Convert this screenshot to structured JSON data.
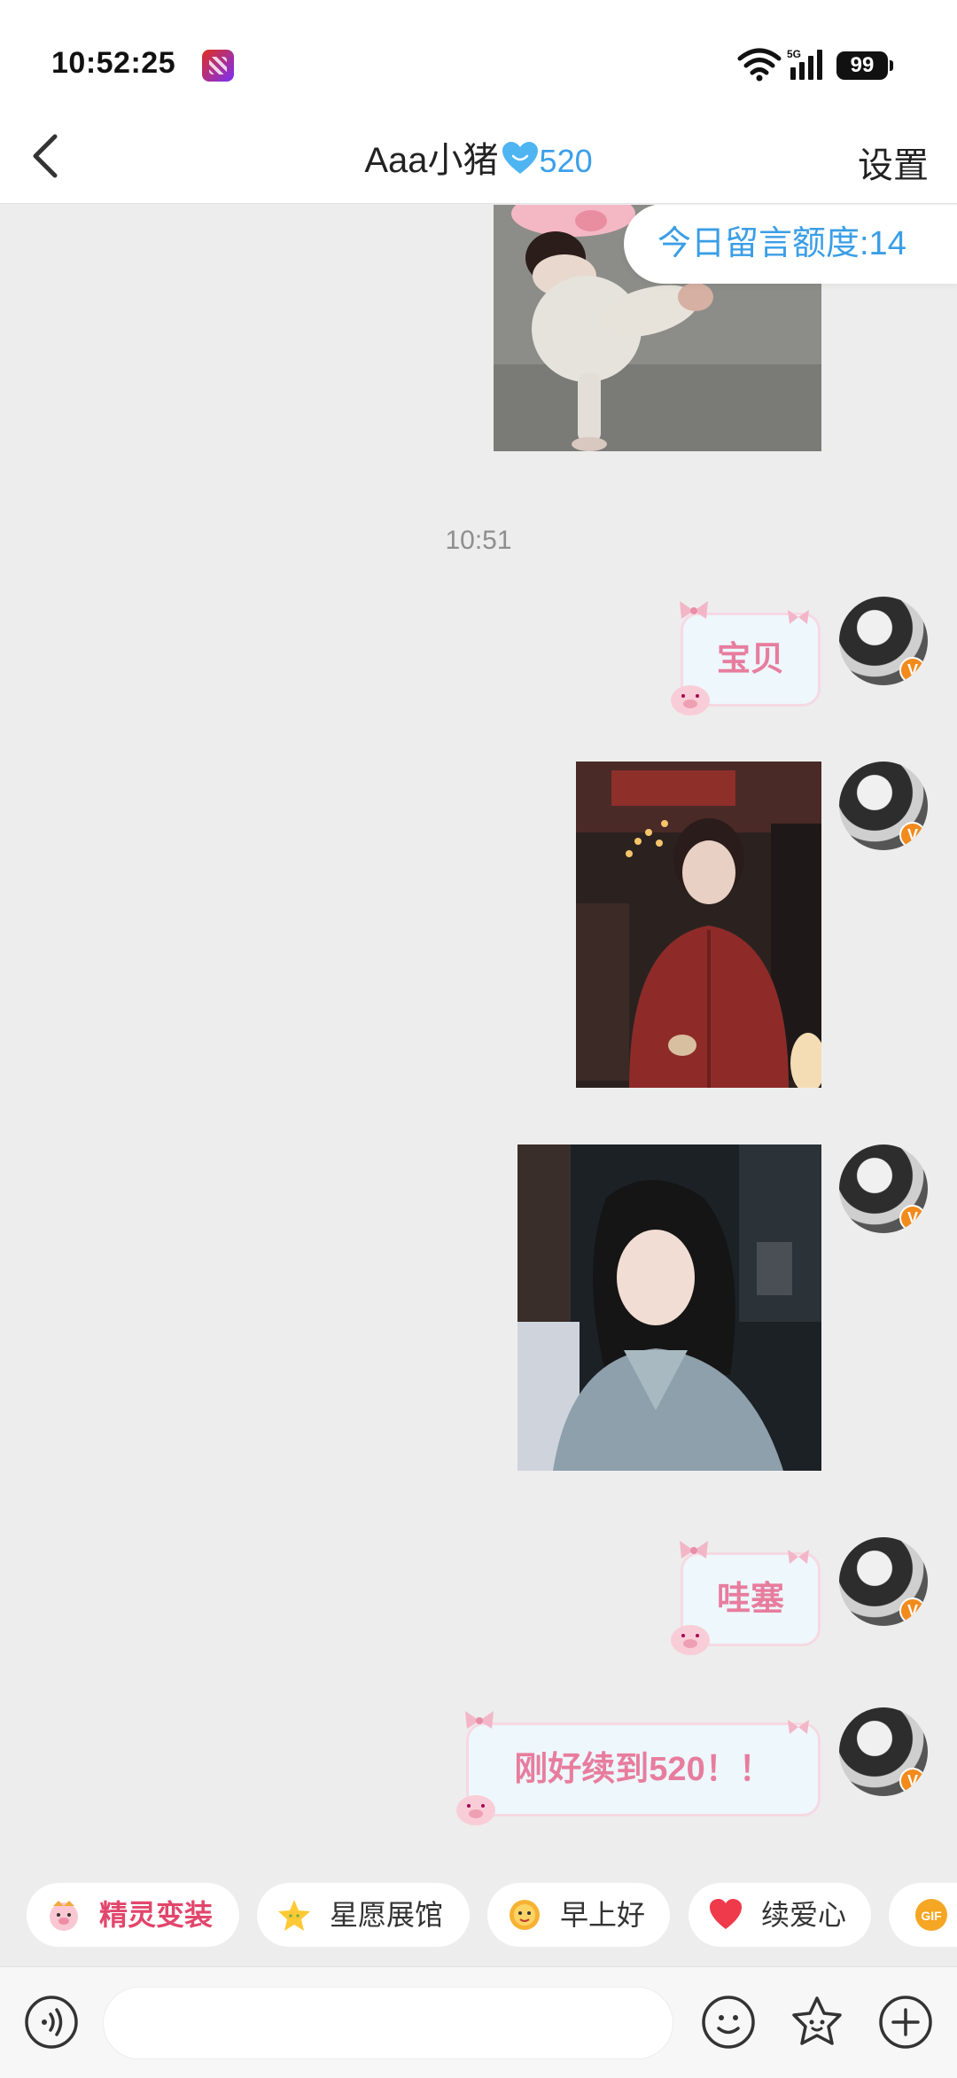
{
  "status_bar": {
    "time": "10:52:25",
    "network": "5G",
    "battery": "99",
    "icons": [
      "app-badge-icon",
      "wifi-icon",
      "signal-icon",
      "battery-icon"
    ]
  },
  "nav": {
    "title": "Aaa小猪",
    "intimacy_score": "520",
    "settings_label": "设置",
    "icons": [
      "back-icon",
      "blue-heart-icon"
    ]
  },
  "quota_badge": "今日留言额度:14",
  "chat": {
    "timestamp": "10:51",
    "messages": [
      {
        "type": "image",
        "description_icon": "pig-figure-photo"
      },
      {
        "type": "text",
        "text": "宝贝"
      },
      {
        "type": "image",
        "description_icon": "girl-red-sweater-photo"
      },
      {
        "type": "image",
        "description_icon": "girl-grey-coat-photo"
      },
      {
        "type": "text",
        "text": "哇塞"
      },
      {
        "type": "text",
        "text": "刚好续到520！！"
      }
    ]
  },
  "quick_actions": [
    {
      "label": "精灵变装",
      "icon": "pig-face-icon"
    },
    {
      "label": "星愿展馆",
      "icon": "star-icon"
    },
    {
      "label": "早上好",
      "icon": "sun-face-icon"
    },
    {
      "label": "续爱心",
      "icon": "heart-icon"
    },
    {
      "label": "GIF",
      "icon": "gif-icon"
    }
  ],
  "input": {
    "placeholder": "",
    "icons": [
      "voice-icon",
      "emoji-icon",
      "sticker-icon",
      "plus-icon"
    ]
  },
  "colors": {
    "accent_blue": "#3a9ee6",
    "bubble_text_pink": "#e77d9e",
    "chip_red": "#e2466c",
    "badge_orange": "#f38b1c",
    "background": "#ededed"
  }
}
